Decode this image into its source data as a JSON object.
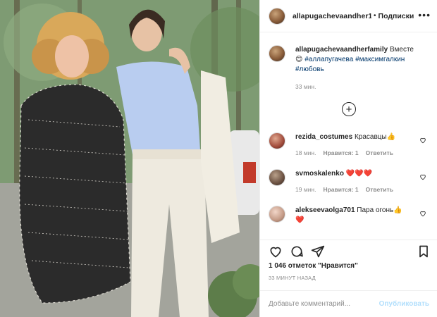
{
  "post": {
    "header": {
      "username": "allapugachevaandher1",
      "separator": "•",
      "follow_label": "Подписки",
      "more_icon": "more-horizontal-icon"
    },
    "caption": {
      "username": "allapugachevaandherfamily",
      "text": "Вместе",
      "emoji": "😊",
      "hashtags": [
        "#аллапугачева",
        "#максимгалкин",
        "#любовь"
      ],
      "time": "33 мин."
    },
    "load_more_icon": "plus-circle-icon",
    "comments": [
      {
        "username": "rezida_costumes",
        "text": "Красавцы👍",
        "time": "18 мин.",
        "likes": "Нравится: 1",
        "reply": "Ответить"
      },
      {
        "username": "svmoskalenko",
        "text": "❤️❤️❤️",
        "time": "19 мин.",
        "likes": "Нравится: 1",
        "reply": "Ответить"
      },
      {
        "username": "alekseevaolga701",
        "text": "Пара огонь👍",
        "text2": "❤️",
        "time": "",
        "likes": "",
        "reply": ""
      }
    ],
    "actions": {
      "like_icon": "heart-icon",
      "comment_icon": "comment-icon",
      "share_icon": "paper-plane-icon",
      "save_icon": "bookmark-icon"
    },
    "likes_text": "1 046 отметок \"Нравится\"",
    "posted_ago": "33 МИНУТ НАЗАД",
    "add_comment": {
      "placeholder": "Добавьте комментарий...",
      "publish_label": "Опубликовать"
    },
    "colors": {
      "link": "#00376b",
      "muted": "#8e8e8e",
      "publish_disabled": "#b2dffc",
      "heart_red": "#ed4956"
    }
  }
}
